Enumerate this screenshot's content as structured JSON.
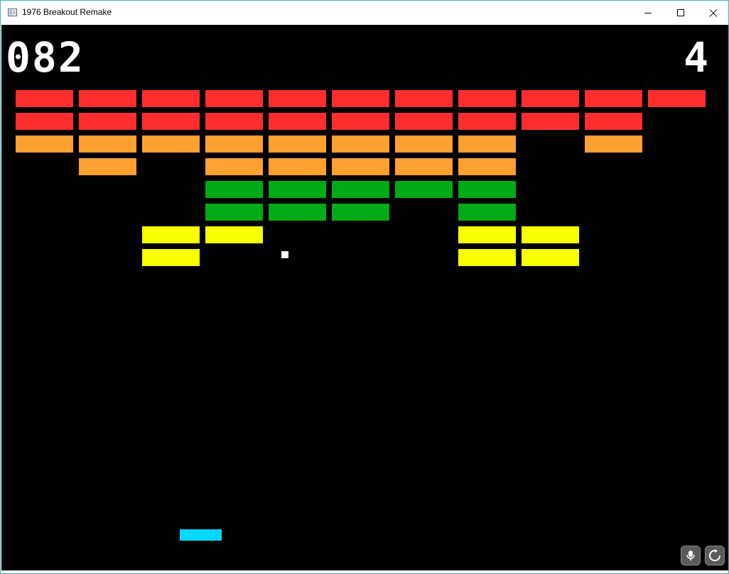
{
  "window": {
    "title": "1976 Breakout Remake"
  },
  "hud": {
    "score": "082",
    "lives": "4"
  },
  "colors": {
    "red": "#ff2e2e",
    "orange": "#ffa030",
    "green": "#00aa16",
    "yellow": "#f8ff00",
    "paddle": "#00d8ff",
    "ball": "#ffffff",
    "background": "#000000"
  },
  "bricks": {
    "columns": 11,
    "rows": [
      {
        "color": "red",
        "present": [
          1,
          1,
          1,
          1,
          1,
          1,
          1,
          1,
          1,
          1,
          1
        ]
      },
      {
        "color": "red",
        "present": [
          1,
          1,
          1,
          1,
          1,
          1,
          1,
          1,
          1,
          1,
          0
        ]
      },
      {
        "color": "orange",
        "present": [
          1,
          1,
          1,
          1,
          1,
          1,
          1,
          1,
          0,
          1,
          0
        ]
      },
      {
        "color": "orange",
        "present": [
          0,
          1,
          0,
          1,
          1,
          1,
          1,
          1,
          0,
          0,
          0
        ]
      },
      {
        "color": "green",
        "present": [
          0,
          0,
          0,
          1,
          1,
          1,
          1,
          1,
          0,
          0,
          0
        ]
      },
      {
        "color": "green",
        "present": [
          0,
          0,
          0,
          1,
          1,
          1,
          0,
          1,
          0,
          0,
          0
        ]
      },
      {
        "color": "yellow",
        "present": [
          0,
          0,
          1,
          1,
          0,
          0,
          0,
          1,
          1,
          0,
          0
        ]
      },
      {
        "color": "yellow",
        "present": [
          0,
          0,
          1,
          0,
          0,
          0,
          0,
          1,
          1,
          0,
          0
        ]
      }
    ]
  },
  "toolbar": {
    "icons": [
      "microphone-icon",
      "rotate-icon"
    ]
  }
}
